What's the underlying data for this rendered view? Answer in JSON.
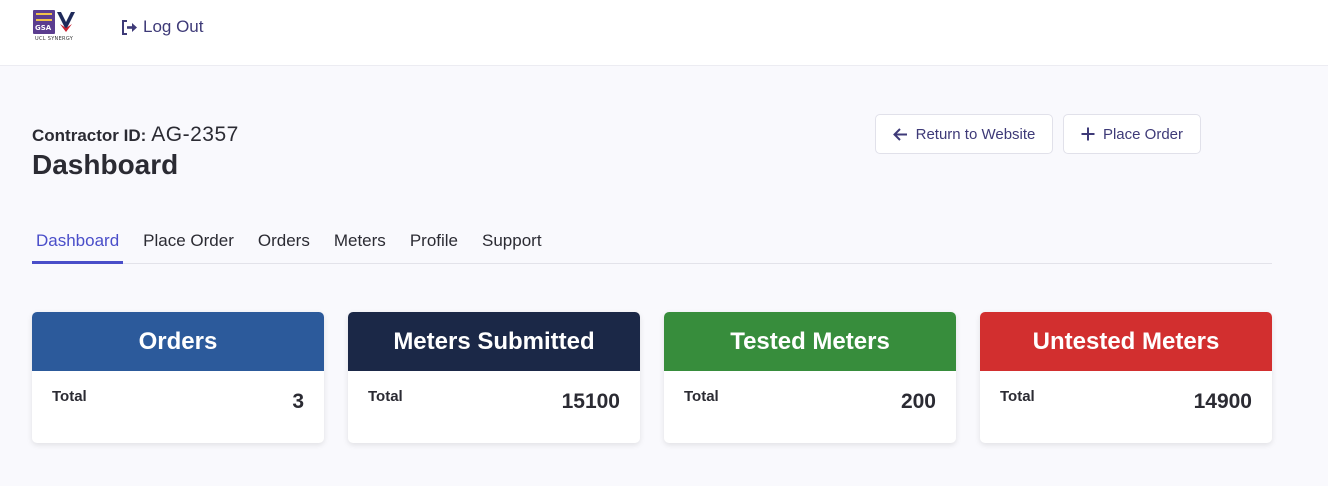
{
  "header": {
    "logo": {
      "badge_text": "GSA",
      "tagline": "UCL SYNERGY"
    },
    "logout_label": "Log Out"
  },
  "page": {
    "contractor_label": "Contractor ID:",
    "contractor_id": "AG-2357",
    "title": "Dashboard"
  },
  "actions": {
    "return_label": "Return to Website",
    "place_order_label": "Place Order"
  },
  "tabs": [
    {
      "label": "Dashboard",
      "active": true
    },
    {
      "label": "Place Order",
      "active": false
    },
    {
      "label": "Orders",
      "active": false
    },
    {
      "label": "Meters",
      "active": false
    },
    {
      "label": "Profile",
      "active": false
    },
    {
      "label": "Support",
      "active": false
    }
  ],
  "cards": [
    {
      "title": "Orders",
      "total_label": "Total",
      "total_value": "3",
      "color": "#2c5a9b"
    },
    {
      "title": "Meters Submitted",
      "total_label": "Total",
      "total_value": "15100",
      "color": "#1b2847"
    },
    {
      "title": "Tested Meters",
      "total_label": "Total",
      "total_value": "200",
      "color": "#378d3c"
    },
    {
      "title": "Untested Meters",
      "total_label": "Total",
      "total_value": "14900",
      "color": "#d22f2f"
    }
  ],
  "colors": {
    "accent": "#4a4ec9",
    "link": "#3e3a78"
  }
}
